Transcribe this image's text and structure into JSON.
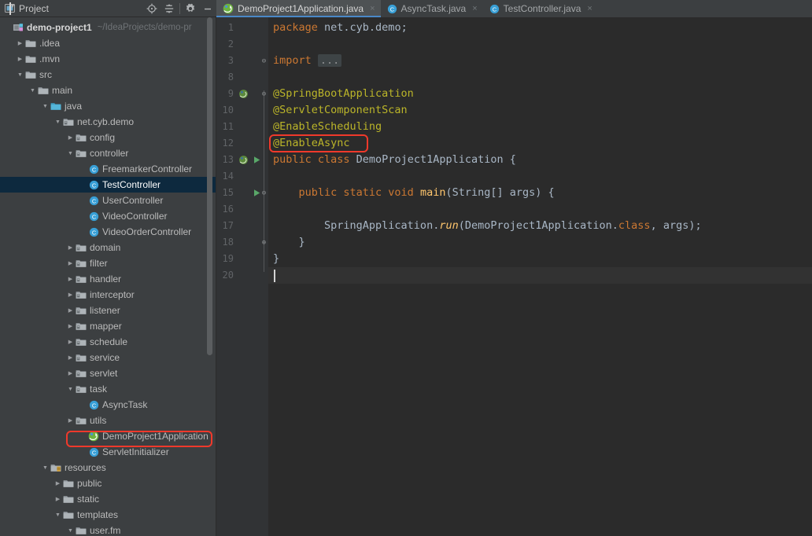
{
  "tool_window": {
    "title": "Project",
    "caret_icon": "chevron-down-icon",
    "buttons": [
      {
        "name": "locate-icon",
        "title": "Select Opened File"
      },
      {
        "name": "collapse-all-icon",
        "title": "Collapse All"
      },
      {
        "name": "settings-gear-icon",
        "title": "Settings"
      },
      {
        "name": "hide-icon",
        "title": "Hide"
      }
    ]
  },
  "tabs": [
    {
      "label": "DemoProject1Application.java",
      "icon": "spring-boot-icon",
      "active": true,
      "close": "×"
    },
    {
      "label": "AsyncTask.java",
      "icon": "java-class-icon",
      "active": false,
      "close": "×"
    },
    {
      "label": "TestController.java",
      "icon": "java-class-icon",
      "active": false,
      "close": "×"
    }
  ],
  "tree": [
    {
      "label": "demo-project1",
      "path": "~/IdeaProjects/demo-pr",
      "indent": 0,
      "arrow": "",
      "icon": "module-icon",
      "bold": true
    },
    {
      "label": ".idea",
      "indent": 1,
      "arrow": "collapsed",
      "icon": "folder-icon"
    },
    {
      "label": ".mvn",
      "indent": 1,
      "arrow": "collapsed",
      "icon": "folder-icon"
    },
    {
      "label": "src",
      "indent": 1,
      "arrow": "expanded",
      "icon": "folder-icon"
    },
    {
      "label": "main",
      "indent": 2,
      "arrow": "expanded",
      "icon": "folder-icon"
    },
    {
      "label": "java",
      "indent": 3,
      "arrow": "expanded",
      "icon": "source-root-icon"
    },
    {
      "label": "net.cyb.demo",
      "indent": 4,
      "arrow": "expanded",
      "icon": "package-icon"
    },
    {
      "label": "config",
      "indent": 5,
      "arrow": "collapsed",
      "icon": "package-icon"
    },
    {
      "label": "controller",
      "indent": 5,
      "arrow": "expanded",
      "icon": "package-icon"
    },
    {
      "label": "FreemarkerController",
      "indent": 6,
      "arrow": "",
      "icon": "java-class-icon"
    },
    {
      "label": "TestController",
      "indent": 6,
      "arrow": "",
      "icon": "java-class-icon",
      "selected": true
    },
    {
      "label": "UserController",
      "indent": 6,
      "arrow": "",
      "icon": "java-class-icon"
    },
    {
      "label": "VideoController",
      "indent": 6,
      "arrow": "",
      "icon": "java-class-icon"
    },
    {
      "label": "VideoOrderController",
      "indent": 6,
      "arrow": "",
      "icon": "java-class-icon"
    },
    {
      "label": "domain",
      "indent": 5,
      "arrow": "collapsed",
      "icon": "package-icon"
    },
    {
      "label": "filter",
      "indent": 5,
      "arrow": "collapsed",
      "icon": "package-icon"
    },
    {
      "label": "handler",
      "indent": 5,
      "arrow": "collapsed",
      "icon": "package-icon"
    },
    {
      "label": "interceptor",
      "indent": 5,
      "arrow": "collapsed",
      "icon": "package-icon"
    },
    {
      "label": "listener",
      "indent": 5,
      "arrow": "collapsed",
      "icon": "package-icon"
    },
    {
      "label": "mapper",
      "indent": 5,
      "arrow": "collapsed",
      "icon": "package-icon"
    },
    {
      "label": "schedule",
      "indent": 5,
      "arrow": "collapsed",
      "icon": "package-icon"
    },
    {
      "label": "service",
      "indent": 5,
      "arrow": "collapsed",
      "icon": "package-icon"
    },
    {
      "label": "servlet",
      "indent": 5,
      "arrow": "collapsed",
      "icon": "package-icon"
    },
    {
      "label": "task",
      "indent": 5,
      "arrow": "expanded",
      "icon": "package-icon"
    },
    {
      "label": "AsyncTask",
      "indent": 6,
      "arrow": "",
      "icon": "java-class-icon"
    },
    {
      "label": "utils",
      "indent": 5,
      "arrow": "collapsed",
      "icon": "package-icon"
    },
    {
      "label": "DemoProject1Application",
      "indent": 6,
      "arrow": "",
      "icon": "spring-boot-icon",
      "highlighted": true
    },
    {
      "label": "ServletInitializer",
      "indent": 6,
      "arrow": "",
      "icon": "java-class-icon"
    },
    {
      "label": "resources",
      "indent": 3,
      "arrow": "expanded",
      "icon": "resource-root-icon"
    },
    {
      "label": "public",
      "indent": 4,
      "arrow": "collapsed",
      "icon": "folder-icon"
    },
    {
      "label": "static",
      "indent": 4,
      "arrow": "collapsed",
      "icon": "folder-icon"
    },
    {
      "label": "templates",
      "indent": 4,
      "arrow": "expanded",
      "icon": "folder-icon"
    },
    {
      "label": "user.fm",
      "indent": 5,
      "arrow": "expanded",
      "icon": "folder-icon"
    }
  ],
  "editor": {
    "line_numbers": [
      "1",
      "2",
      "3",
      "8",
      "9",
      "10",
      "11",
      "12",
      "13",
      "14",
      "15",
      "16",
      "17",
      "18",
      "19",
      "20"
    ],
    "code_lines": [
      {
        "num": "1",
        "segments": [
          {
            "t": "package",
            "c": "k"
          },
          {
            "t": " net.cyb.demo;",
            "c": "txt"
          }
        ]
      },
      {
        "num": "2",
        "segments": []
      },
      {
        "num": "3",
        "segments": [
          {
            "t": "import",
            "c": "k"
          },
          {
            "t": " ",
            "c": "txt"
          },
          {
            "t": "...",
            "c": "fold"
          }
        ]
      },
      {
        "num": "8",
        "segments": []
      },
      {
        "num": "9",
        "segments": [
          {
            "t": "@SpringBootApplication",
            "c": "ann"
          }
        ]
      },
      {
        "num": "10",
        "segments": [
          {
            "t": "@ServletComponentScan",
            "c": "ann"
          }
        ]
      },
      {
        "num": "11",
        "segments": [
          {
            "t": "@EnableScheduling",
            "c": "ann"
          }
        ]
      },
      {
        "num": "12",
        "segments": [
          {
            "t": "@EnableAsync",
            "c": "ann"
          }
        ]
      },
      {
        "num": "13",
        "segments": [
          {
            "t": "public class",
            "c": "k"
          },
          {
            "t": " DemoProject1Application {",
            "c": "txt"
          }
        ]
      },
      {
        "num": "14",
        "segments": []
      },
      {
        "num": "15",
        "segments": [
          {
            "t": "    ",
            "c": "txt"
          },
          {
            "t": "public static void",
            "c": "k"
          },
          {
            "t": " ",
            "c": "txt"
          },
          {
            "t": "main",
            "c": "fn"
          },
          {
            "t": "(String[] args) {",
            "c": "txt"
          }
        ]
      },
      {
        "num": "16",
        "segments": []
      },
      {
        "num": "17",
        "segments": [
          {
            "t": "        SpringApplication.",
            "c": "txt"
          },
          {
            "t": "run",
            "c": "fni"
          },
          {
            "t": "(DemoProject1Application.",
            "c": "txt"
          },
          {
            "t": "class",
            "c": "k"
          },
          {
            "t": ", args);",
            "c": "txt"
          }
        ]
      },
      {
        "num": "18",
        "segments": [
          {
            "t": "    }",
            "c": "txt"
          }
        ]
      },
      {
        "num": "19",
        "segments": [
          {
            "t": "}",
            "c": "txt"
          }
        ]
      },
      {
        "num": "20",
        "segments": []
      }
    ],
    "gutter_icons": [
      {
        "line": "9",
        "name": "spring-bean-icon"
      },
      {
        "line": "13",
        "name": "spring-bean-icon"
      },
      {
        "line": "13",
        "name": "run-gutter-icon"
      },
      {
        "line": "15",
        "name": "run-gutter-icon"
      }
    ],
    "caret_line": "20"
  },
  "annotations": [
    {
      "name": "enable-async-highlight",
      "target": "@EnableAsync",
      "color": "#f0392b"
    },
    {
      "name": "demo-application-highlight",
      "target": "DemoProject1Application",
      "color": "#f0392b"
    }
  ]
}
